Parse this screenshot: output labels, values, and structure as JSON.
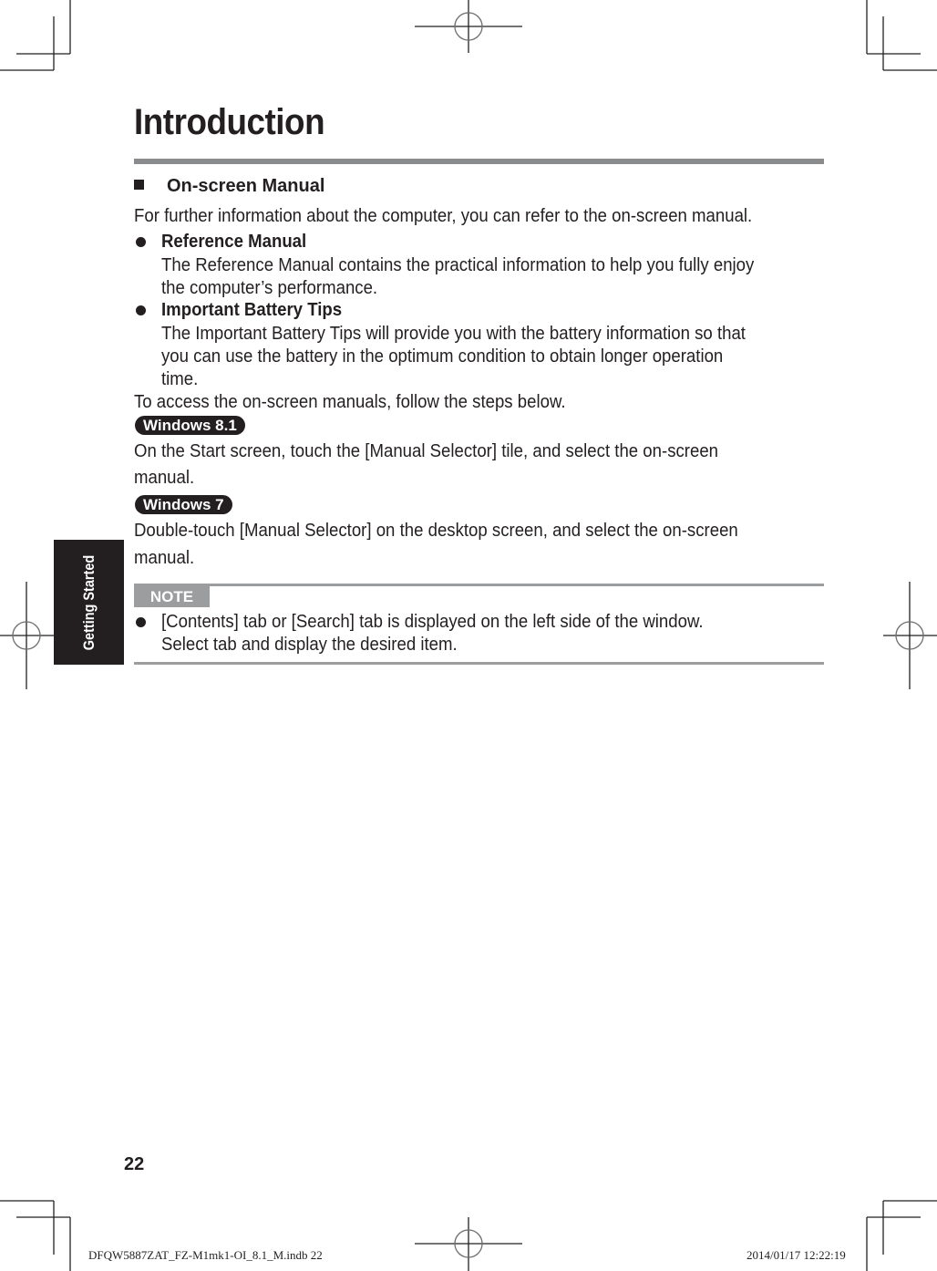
{
  "page": {
    "title": "Introduction",
    "section_heading": "On-screen Manual",
    "intro_text": "For further information about the computer, you can refer to the on-screen manual.",
    "bullets": [
      {
        "heading": "Reference Manual",
        "lines": [
          "The Reference Manual contains the practical information to help you fully enjoy",
          "the computer’s performance."
        ]
      },
      {
        "heading": "Important Battery Tips",
        "lines": [
          "The Important Battery Tips will provide you with the battery information so that",
          "you can use the battery in the optimum condition to obtain longer operation",
          "time."
        ]
      }
    ],
    "access_text": "To access the on-screen manuals, follow the steps below.",
    "os_steps": [
      {
        "badge": "Windows 8.1",
        "lines": [
          "On the Start screen, touch the [Manual Selector] tile, and select the on-screen",
          "manual."
        ]
      },
      {
        "badge": "Windows 7",
        "lines": [
          "Double-touch [Manual Selector] on the desktop screen, and select the on-screen",
          "manual."
        ]
      }
    ],
    "note": {
      "label": "NOTE",
      "lines": [
        "[Contents] tab or [Search] tab is displayed on the left side of the window.",
        "Select tab and display the desired item."
      ]
    },
    "side_tab": "Getting Started",
    "page_number": "22"
  },
  "footer": {
    "file_name": "DFQW5887ZAT_FZ-M1mk1-OI_8.1_M.indb   22",
    "timestamp": "2014/01/17   12:22:19"
  },
  "colors": {
    "text": "#231f20",
    "rule_gray": "#8a8b8d",
    "note_gray": "#9c9d9f"
  }
}
